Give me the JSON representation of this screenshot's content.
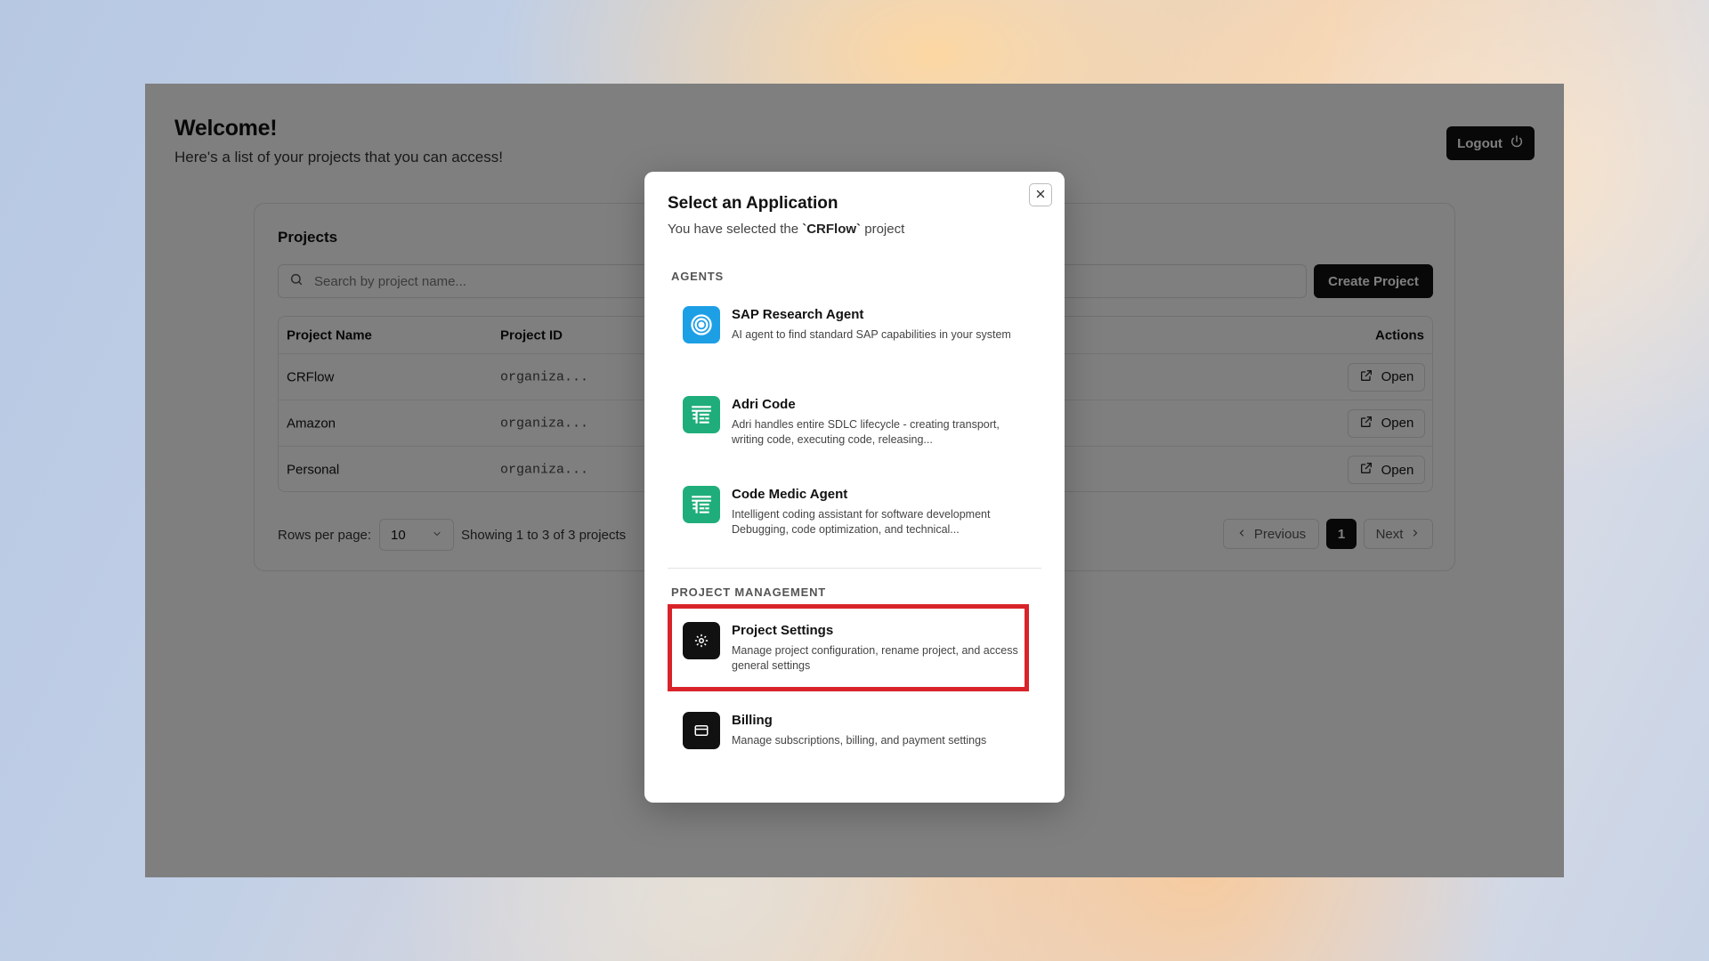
{
  "welcome": {
    "title": "Welcome!",
    "subtitle": "Here's a list of your projects that you can access!"
  },
  "logout": {
    "label": "Logout"
  },
  "projects": {
    "title": "Projects",
    "search_placeholder": "Search by project name...",
    "create_label": "Create Project",
    "columns": {
      "name": "Project Name",
      "id": "Project ID",
      "actions": "Actions"
    },
    "rows": [
      {
        "name": "CRFlow",
        "id": "organiza...",
        "action": "Open"
      },
      {
        "name": "Amazon",
        "id": "organiza...",
        "action": "Open"
      },
      {
        "name": "Personal",
        "id": "organiza...",
        "action": "Open"
      }
    ],
    "pager": {
      "rows_per_page_label": "Rows per page:",
      "rows_per_page_value": "10",
      "showing": "Showing 1 to 3 of 3 projects",
      "previous": "Previous",
      "page": "1",
      "next": "Next"
    }
  },
  "modal": {
    "title": "Select an Application",
    "subtitle_prefix": "You have selected the ",
    "subtitle_project": "`CRFlow`",
    "subtitle_suffix": " project",
    "agents_label": "AGENTS",
    "pm_label": "PROJECT MANAGEMENT",
    "agents": [
      {
        "name": "SAP Research Agent",
        "desc": "AI agent to find standard SAP capabilities in your system",
        "icon": "target-icon",
        "color": "#1d9fe6"
      },
      {
        "name": "Adri Code",
        "desc": "Adri handles entire SDLC lifecycle - creating transport, writing code, executing code, releasing...",
        "icon": "code-table-icon",
        "color": "#1fae7b"
      },
      {
        "name": "Code Medic Agent",
        "desc": "Intelligent coding assistant for software development Debugging, code optimization, and technical...",
        "icon": "code-table-icon",
        "color": "#1fae7b"
      }
    ],
    "management": [
      {
        "name": "Project Settings",
        "desc": "Manage project configuration, rename project, and access general settings",
        "icon": "gear-icon",
        "color": "#111111"
      },
      {
        "name": "Billing",
        "desc": "Manage subscriptions, billing, and payment settings",
        "icon": "credit-card-icon",
        "color": "#111111"
      }
    ]
  },
  "colors": {
    "highlight": "#d9232a",
    "primary": "#111111"
  }
}
